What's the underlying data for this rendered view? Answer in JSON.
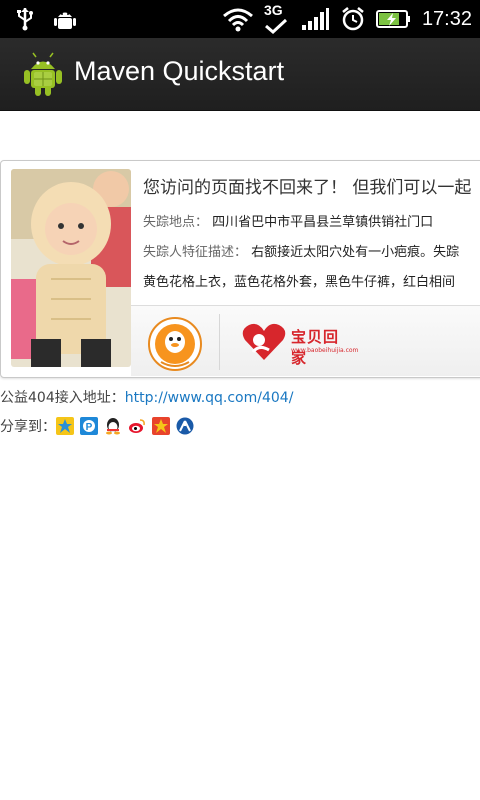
{
  "status_bar": {
    "time": "17:32",
    "network": "3G",
    "icons": [
      "usb-icon",
      "android-debug-icon",
      "wifi-icon",
      "3g-icon",
      "signal-icon",
      "alarm-icon",
      "battery-charging-icon"
    ]
  },
  "action_bar": {
    "title": "Maven Quickstart",
    "icon": "android-icon"
  },
  "card": {
    "title": "您访问的页面找不回来了！ 但我们可以一起",
    "lines": [
      {
        "label": "失踪地点：",
        "value": "四川省巴中市平昌县兰草镇供销社门口"
      },
      {
        "label": "失踪人特征描述：",
        "value": "右额接近太阳穴处有一小疤痕。失踪"
      },
      {
        "label": "",
        "value": "黄色花格上衣，蓝色花格外套，黑色牛仔裤，红白相间"
      }
    ],
    "logos": {
      "tencent_volunteer": "tencent-volunteer-logo",
      "baobei_huijia": "宝贝回家",
      "baobei_url": "www.baobeihuijia.com"
    }
  },
  "footer": {
    "url_label": "公益404接入地址：",
    "url": "http://www.qq.com/404/",
    "share_label": "分享到：",
    "share_icons": [
      "qzone-icon",
      "pengyou-icon",
      "qq-icon",
      "weibo-icon",
      "shuoshuo-icon",
      "renren-icon"
    ]
  },
  "colors": {
    "link": "#1a78c2",
    "actionbar": "#222222",
    "android_green": "#97c024"
  }
}
